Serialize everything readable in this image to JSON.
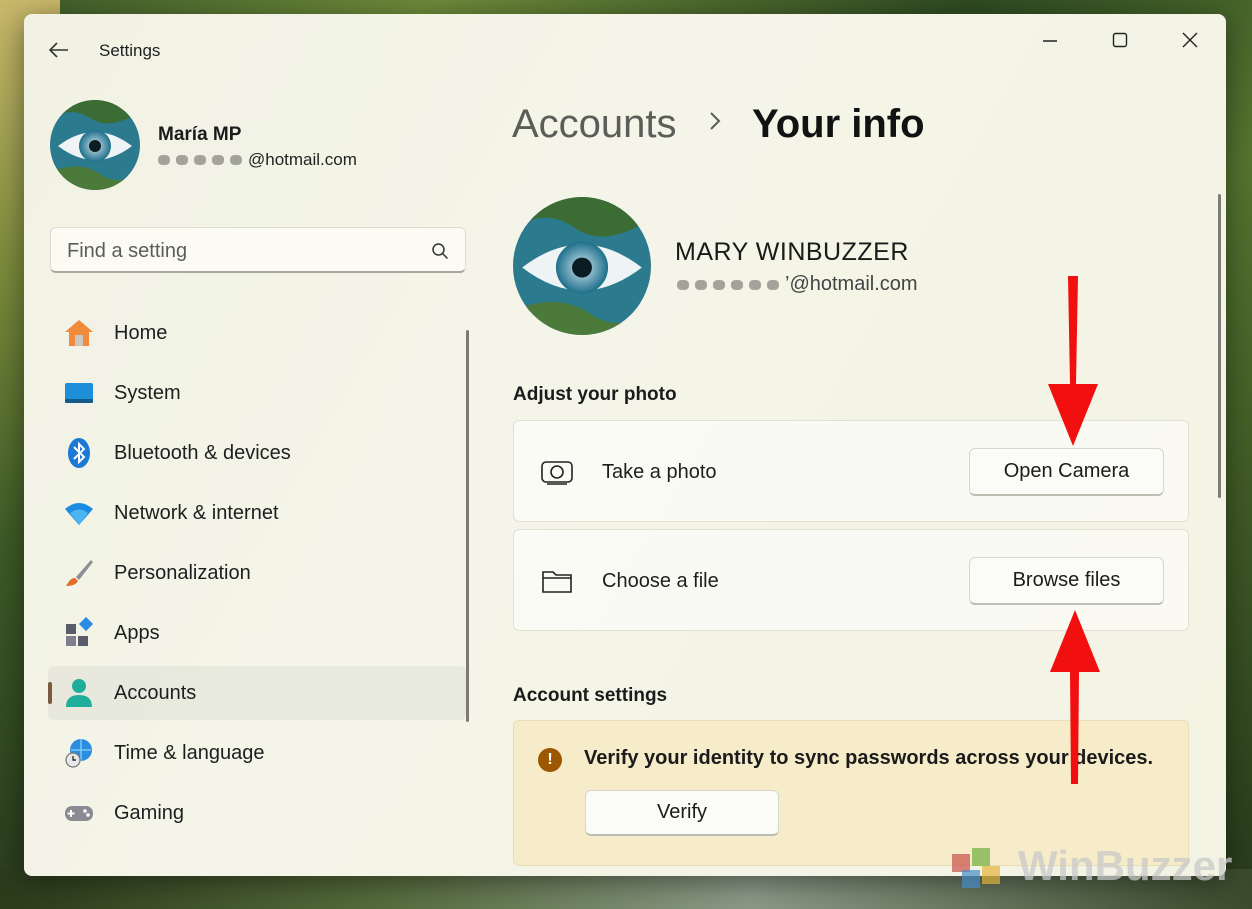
{
  "window": {
    "title": "Settings"
  },
  "profile": {
    "name": "María MP",
    "email_suffix": "@hotmail.com"
  },
  "search": {
    "placeholder": "Find a setting"
  },
  "sidebar": {
    "items": [
      {
        "label": "Home",
        "icon": "home-icon",
        "active": false
      },
      {
        "label": "System",
        "icon": "system-icon",
        "active": false
      },
      {
        "label": "Bluetooth & devices",
        "icon": "bluetooth-icon",
        "active": false
      },
      {
        "label": "Network & internet",
        "icon": "wifi-icon",
        "active": false
      },
      {
        "label": "Personalization",
        "icon": "brush-icon",
        "active": false
      },
      {
        "label": "Apps",
        "icon": "apps-icon",
        "active": false
      },
      {
        "label": "Accounts",
        "icon": "person-icon",
        "active": true
      },
      {
        "label": "Time & language",
        "icon": "globe-clock-icon",
        "active": false
      },
      {
        "label": "Gaming",
        "icon": "gamepad-icon",
        "active": false
      }
    ]
  },
  "breadcrumb": {
    "parent": "Accounts",
    "separator": ">",
    "current": "Your info"
  },
  "account": {
    "display_name": "MARY WINBUZZER",
    "email_suffix": "’@hotmail.com"
  },
  "adjust_photo": {
    "heading": "Adjust your photo",
    "take_photo": {
      "label": "Take a photo",
      "button": "Open Camera"
    },
    "choose_file": {
      "label": "Choose a file",
      "button": "Browse files"
    }
  },
  "account_settings": {
    "heading": "Account settings",
    "warning_text": "Verify your identity to sync passwords across your devices.",
    "verify_button": "Verify"
  },
  "watermark": {
    "text": "WinBuzzer"
  },
  "colors": {
    "accent": "#7a5a3c",
    "warning_bg": "#f6ecc9",
    "warning_icon": "#9c5700",
    "annotation_arrow": "#f20f0f"
  }
}
